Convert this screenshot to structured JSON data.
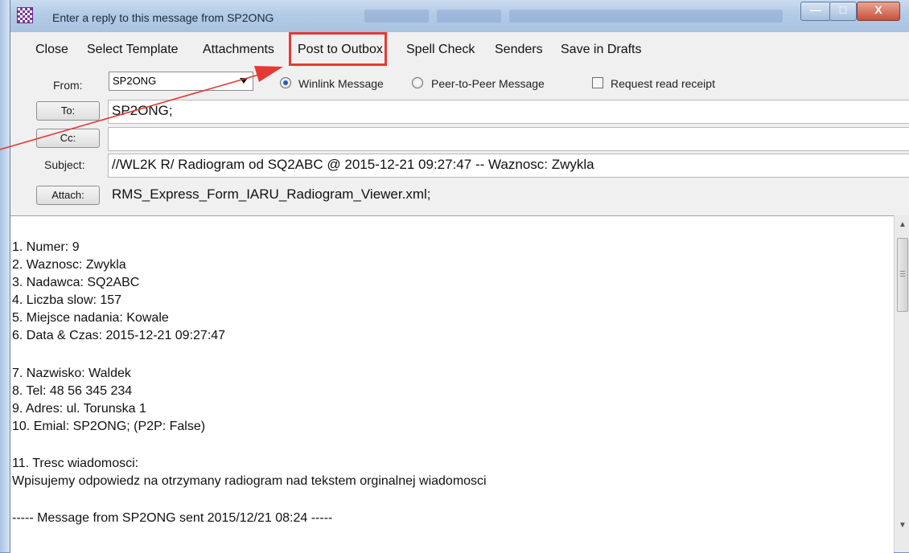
{
  "window": {
    "title": "Enter a reply to this message from SP2ONG",
    "minimize_label": "—",
    "maximize_label": "□",
    "close_label": "X"
  },
  "menu": {
    "close": "Close",
    "select_template": "Select Template",
    "attachments": "Attachments",
    "post_to_outbox": "Post to Outbox",
    "spell_check": "Spell Check",
    "senders": "Senders",
    "save_in_drafts": "Save in Drafts"
  },
  "form": {
    "from_label": "From:",
    "from_value": "SP2ONG",
    "winlink_label": "Winlink Message",
    "p2p_label": "Peer-to-Peer Message",
    "read_receipt_label": "Request read receipt",
    "to_button": "To:",
    "to_value": "SP2ONG;",
    "cc_button": "Cc:",
    "cc_value": "",
    "subject_label": "Subject:",
    "subject_value": "//WL2K R/ Radiogram od SQ2ABC @ 2015-12-21 09:27:47 --  Waznosc: Zwykla",
    "attach_button": "Attach:",
    "attach_value": "RMS_Express_Form_IARU_Radiogram_Viewer.xml;"
  },
  "body_lines": [
    "1. Numer: 9",
    "2. Waznosc: Zwykla",
    "3. Nadawca: SQ2ABC",
    "4. Liczba slow: 157",
    "5. Miejsce nadania: Kowale",
    "6. Data & Czas: 2015-12-21 09:27:47",
    "7. Nazwisko: Waldek",
    "8. Tel: 48 56 345 234",
    "9. Adres: ul. Torunska 1",
    "10. Emial: SP2ONG;  (P2P: False)",
    "11. Tresc wiadomosci:",
    "Wpisujemy odpowiedz na otrzymany radiogram nad tekstem orginalnej wiadomosci",
    "----- Message from SP2ONG sent 2015/12/21 08:24 -----"
  ],
  "colors": {
    "highlight": "#e53935",
    "radio_selected": "#1f5fc0"
  }
}
